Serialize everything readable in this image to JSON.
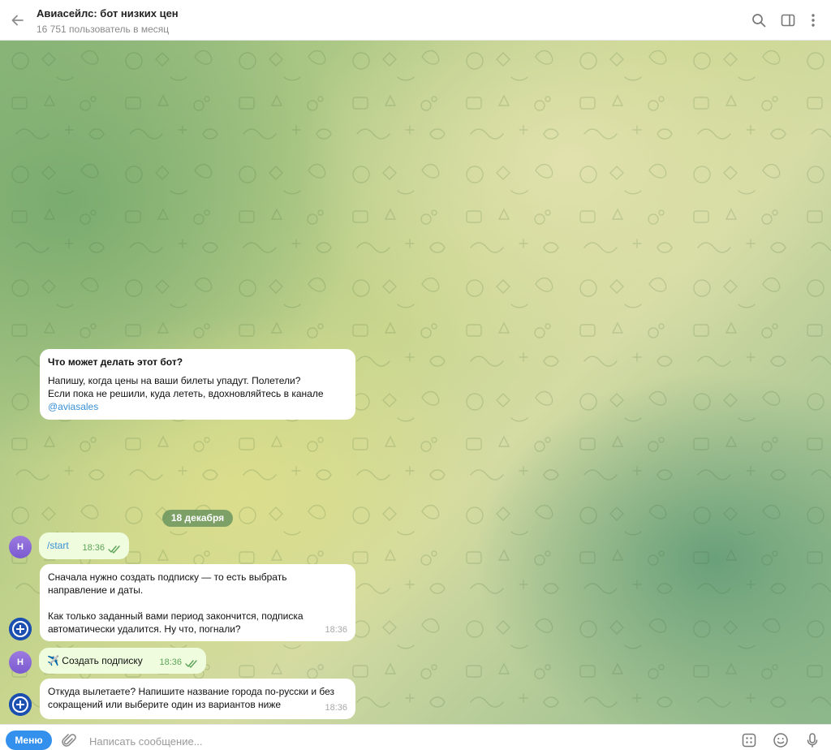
{
  "header": {
    "title": "Авиасейлс: бот низких цен",
    "subtitle": "16 751 пользователь в месяц",
    "icons": [
      "back-arrow-icon",
      "search-icon",
      "sidebar-toggle-icon",
      "more-vertical-icon"
    ]
  },
  "intro_card": {
    "question": "Что может делать этот бот?",
    "line1": "Напишу, когда цены на ваши билеты упадут. Полетели?",
    "line2": "Если пока не решили, куда лететь, вдохновляйтесь в канале",
    "link": "@aviasales"
  },
  "date_separator": "18 декабря",
  "messages": [
    {
      "from": "user",
      "avatar": "Н",
      "text": "/start",
      "time": "18:36"
    },
    {
      "from": "bot",
      "para1_line1": "Сначала нужно создать подписку — то есть выбрать",
      "para1_line2": "направление и даты.",
      "para2_line1": "Как только заданный вами период закончится, подписка",
      "para2_line2": "автоматически удалится. Ну что, погнали?",
      "time": "18:36"
    },
    {
      "from": "user",
      "avatar": "Н",
      "emoji": "✈️",
      "text": "Создать подписку",
      "time": "18:36"
    },
    {
      "from": "bot",
      "line1": "Откуда вылетаете? Напишите название города по-русски и без",
      "line2": "сокращений или выберите один из вариантов ниже",
      "time": "18:36"
    }
  ],
  "composer": {
    "menu_label": "Меню",
    "placeholder": "Написать сообщение...",
    "icons": [
      "attach-icon",
      "commands-icon",
      "emoji-icon",
      "microphone-icon"
    ]
  },
  "colors": {
    "accent": "#3390ec",
    "link": "#3a8fd4",
    "outgoing_bubble": "#effdde",
    "check": "#5ea35a"
  }
}
